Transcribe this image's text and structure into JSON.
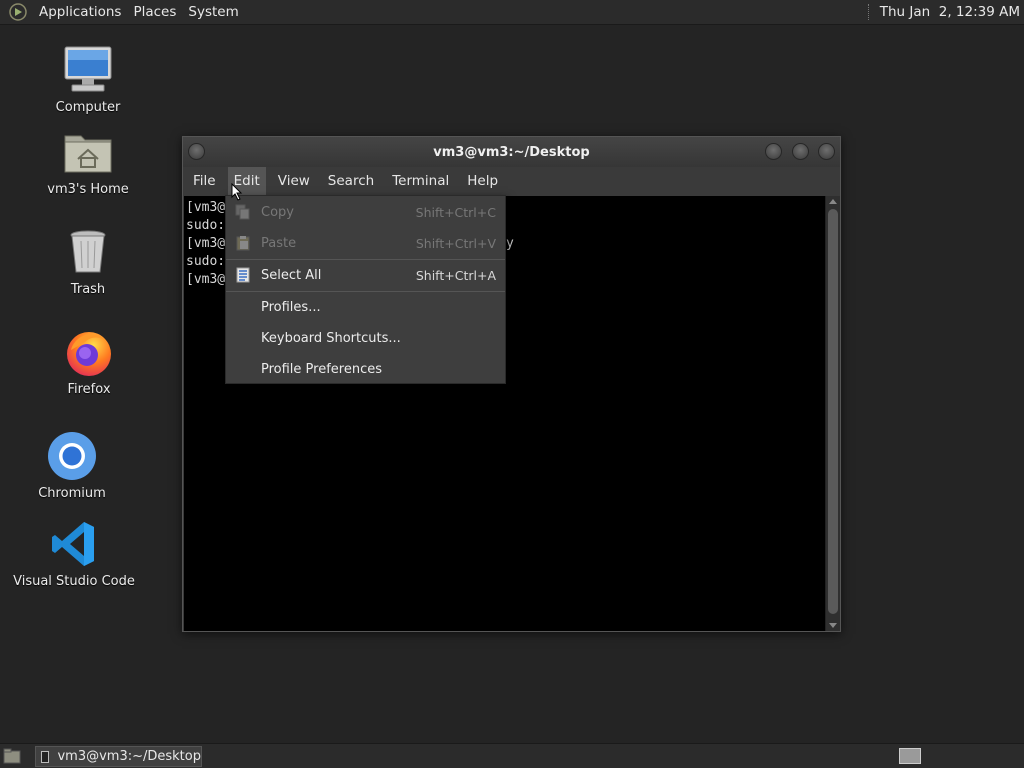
{
  "top_panel": {
    "menus": [
      "Applications",
      "Places",
      "System"
    ],
    "clock": "Thu Jan  2, 12:39 AM"
  },
  "desktop": {
    "icons": [
      {
        "label": "Computer",
        "icon": "computer-icon"
      },
      {
        "label": "vm3's Home",
        "icon": "home-folder-icon"
      },
      {
        "label": "Trash",
        "icon": "trash-icon"
      },
      {
        "label": "Firefox",
        "icon": "firefox-icon"
      },
      {
        "label": "Chromium",
        "icon": "chromium-icon"
      },
      {
        "label": "Visual Studio Code",
        "icon": "vscode-icon"
      }
    ]
  },
  "terminal": {
    "title": "vm3@vm3:~/Desktop",
    "menubar": [
      "File",
      "Edit",
      "View",
      "Search",
      "Terminal",
      "Help"
    ],
    "active_menu": "Edit",
    "lines": [
      "[vm3@",
      "sudo:",
      "[vm3@",
      "sudo:",
      "[vm3@"
    ],
    "visible_fragment": "y"
  },
  "edit_menu": {
    "items": [
      {
        "label": "Copy",
        "accel": "Shift+Ctrl+C",
        "enabled": false,
        "icon": "copy-icon"
      },
      {
        "label": "Paste",
        "accel": "Shift+Ctrl+V",
        "enabled": false,
        "icon": "paste-icon"
      },
      {
        "label": "Select All",
        "accel": "Shift+Ctrl+A",
        "enabled": true,
        "icon": "select-all-icon"
      },
      {
        "label": "Profiles...",
        "accel": "",
        "enabled": true
      },
      {
        "label": "Keyboard Shortcuts...",
        "accel": "",
        "enabled": true
      },
      {
        "label": "Profile Preferences",
        "accel": "",
        "enabled": true
      }
    ]
  },
  "taskbar": {
    "task_label": "vm3@vm3:~/Desktop"
  },
  "colors": {
    "desktop_bg": "#242424",
    "panel_bg": "#2b2b2b",
    "terminal_bg": "#000000",
    "menu_bg": "#3e3e3e"
  }
}
